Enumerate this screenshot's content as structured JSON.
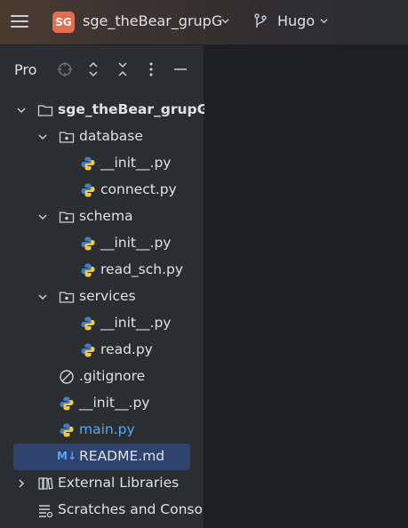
{
  "header": {
    "project_badge": "SG",
    "project_name": "sge_theBear_grupG",
    "branch": "Hugo"
  },
  "panel": {
    "title": "Pro"
  },
  "tree": [
    {
      "label": "sge_theBear_grupG",
      "icon": "folder-icon"
    },
    {
      "label": "database",
      "icon": "package-folder-icon"
    },
    {
      "label": "__init__.py",
      "icon": "python-file-icon"
    },
    {
      "label": "connect.py",
      "icon": "python-file-icon"
    },
    {
      "label": "schema",
      "icon": "package-folder-icon"
    },
    {
      "label": "__init__.py",
      "icon": "python-file-icon"
    },
    {
      "label": "read_sch.py",
      "icon": "python-file-icon"
    },
    {
      "label": "services",
      "icon": "package-folder-icon"
    },
    {
      "label": "__init__.py",
      "icon": "python-file-icon"
    },
    {
      "label": "read.py",
      "icon": "python-file-icon"
    },
    {
      "label": ".gitignore",
      "icon": "ignored-file-icon"
    },
    {
      "label": "__init__.py",
      "icon": "python-file-icon"
    },
    {
      "label": "main.py",
      "icon": "python-file-icon"
    },
    {
      "label": "README.md",
      "icon": "markdown-file-icon",
      "icon_text": "M↓"
    },
    {
      "label": "External Libraries",
      "icon": "library-icon"
    },
    {
      "label": "Scratches and Consoles",
      "icon": "scratches-icon"
    }
  ],
  "colors": {
    "accent": "#e36d4e",
    "selection": "#2e436e",
    "link_blue": "#56a8f5"
  }
}
